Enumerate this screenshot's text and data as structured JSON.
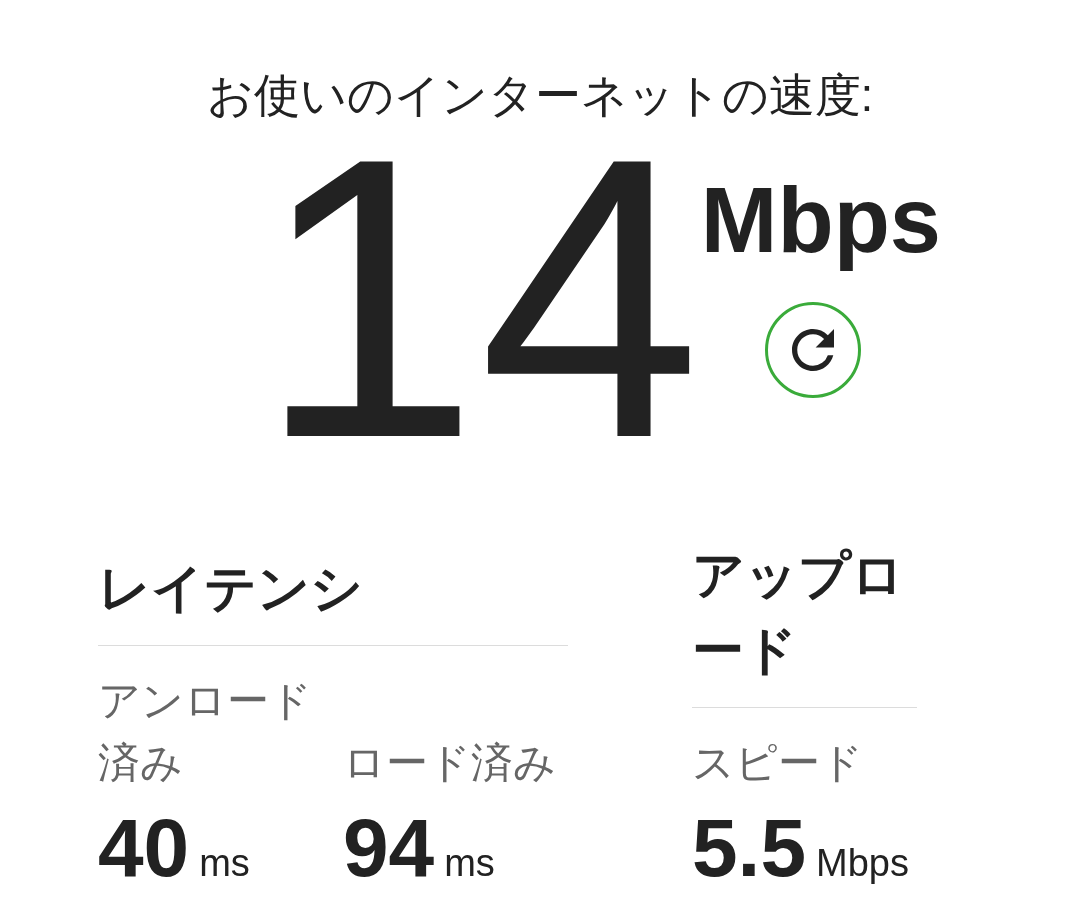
{
  "title": "お使いのインターネットの速度:",
  "speed": {
    "value": "14",
    "unit": "Mbps"
  },
  "sections": [
    {
      "heading": "レイテンシ",
      "metrics": [
        {
          "label": "アンロード済み",
          "value": "40",
          "unit": "ms"
        },
        {
          "label": "ロード済み",
          "value": "94",
          "unit": "ms"
        }
      ]
    },
    {
      "heading": "アップロード",
      "metrics": [
        {
          "label": "スピード",
          "value": "5.5",
          "unit": "Mbps"
        }
      ]
    }
  ]
}
